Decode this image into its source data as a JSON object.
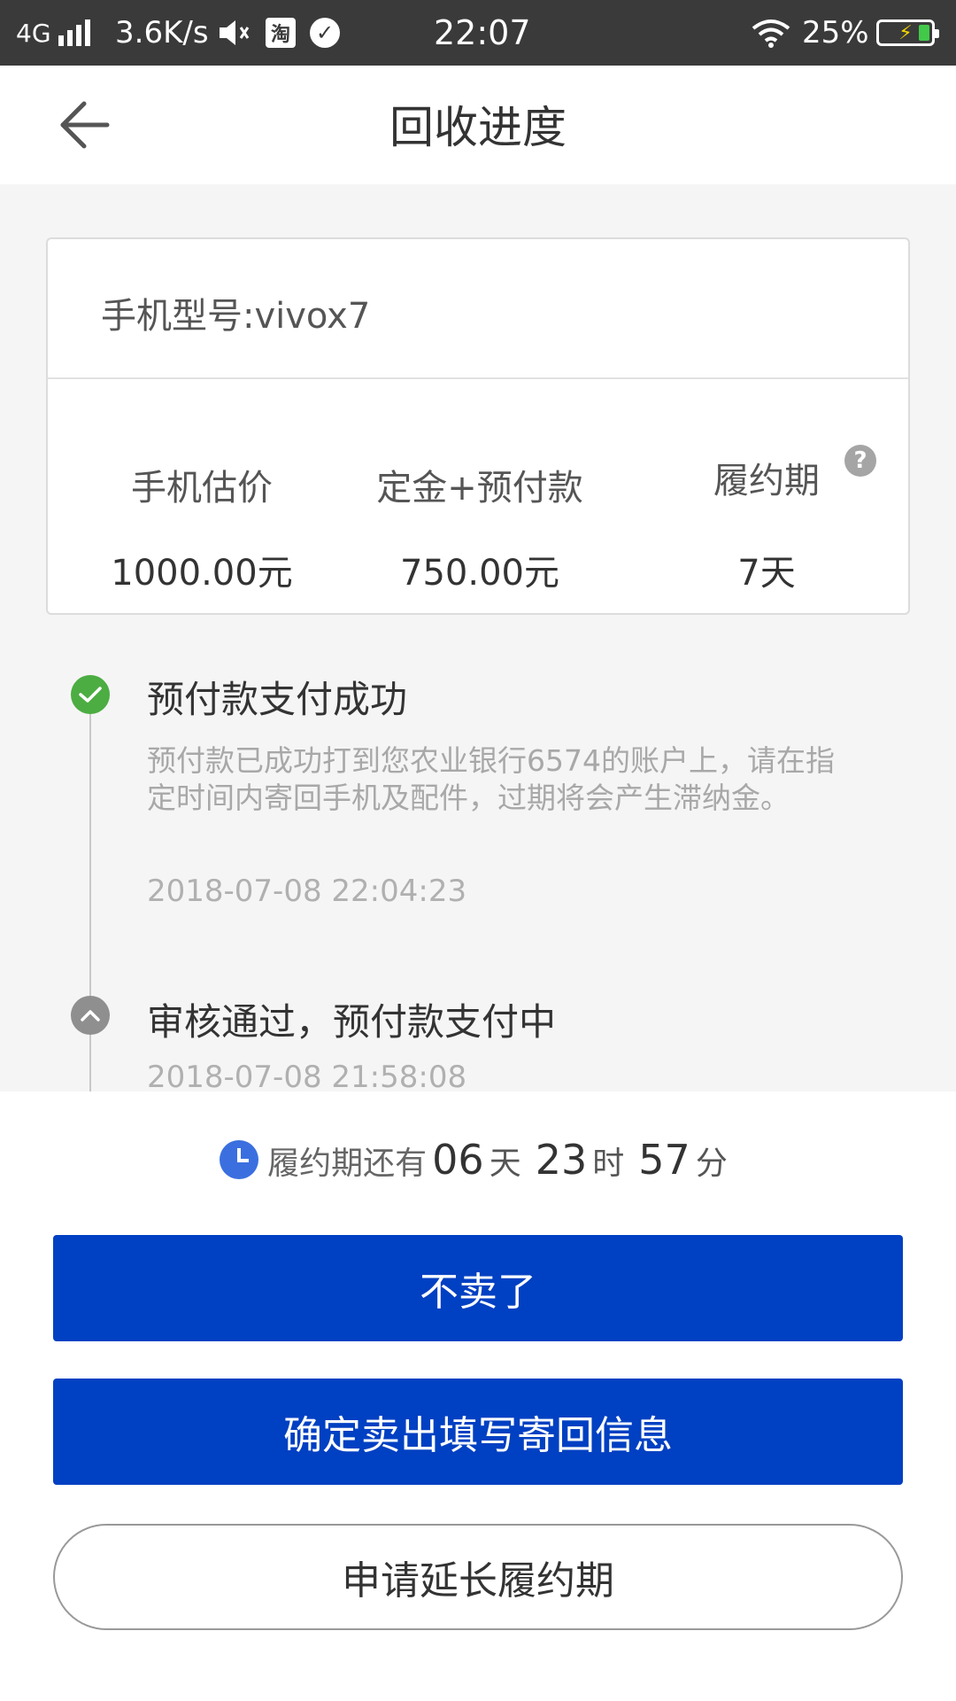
{
  "status_bar": {
    "network": "4G",
    "speed": "3.6K/s",
    "taobao": "淘",
    "time": "22:07",
    "battery": "25%",
    "icons": [
      "signal-icon",
      "mute-icon",
      "taobao-icon",
      "check-icon",
      "wifi-icon",
      "battery-icon"
    ]
  },
  "header": {
    "title": "回收进度",
    "back_icon": "arrow-left-icon"
  },
  "card": {
    "model": "手机型号:vivox7",
    "stats": [
      {
        "label": "手机估价",
        "value": "1000.00元"
      },
      {
        "label": "定金+预付款",
        "value": "750.00元"
      },
      {
        "label": "履约期",
        "value": "7天"
      }
    ],
    "help_glyph": "?"
  },
  "timeline": [
    {
      "title": "预付款支付成功",
      "desc": "预付款已成功打到您农业银行6574的账户上，请在指定时间内寄回手机及配件，过期将会产生滞纳金。",
      "time": "2018-07-08 22:04:23",
      "status": "done",
      "color": "#4cad42"
    },
    {
      "title": "审核通过，预付款支付中",
      "time": "2018-07-08 21:58:08",
      "status": "collapsed",
      "color": "#8f8f8f"
    }
  ],
  "countdown": {
    "label": "履约期还有",
    "days": "06",
    "days_unit": "天",
    "hours": "23",
    "hours_unit": "时",
    "minutes": "57",
    "minutes_unit": "分"
  },
  "buttons": {
    "cancel_sale": "不卖了",
    "confirm_sale": "确定卖出填写寄回信息",
    "extend_period": "申请延长履约期"
  },
  "colors": {
    "primary": "#0040c2",
    "success": "#4cad42",
    "clock": "#3b6fe0"
  }
}
